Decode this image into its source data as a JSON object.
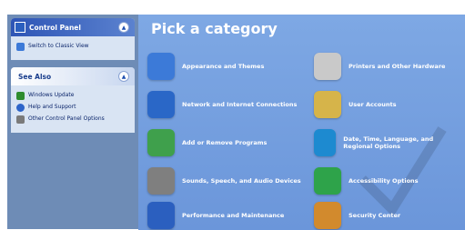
{
  "sidebar": {
    "control_panel": {
      "title": "Control Panel",
      "items": [
        {
          "label": "Switch to Classic View",
          "icon": "switch-icon"
        }
      ]
    },
    "see_also": {
      "title": "See Also",
      "items": [
        {
          "label": "Windows Update",
          "icon": "windows-update-icon"
        },
        {
          "label": "Help and Support",
          "icon": "help-icon"
        },
        {
          "label": "Other Control Panel Options",
          "icon": "options-icon"
        }
      ]
    }
  },
  "main": {
    "heading": "Pick a category",
    "categories": [
      {
        "label": "Appearance and Themes",
        "icon": "appearance-icon",
        "color": "#3c7ad8"
      },
      {
        "label": "Network and Internet Connections",
        "icon": "network-icon",
        "color": "#2a67c7"
      },
      {
        "label": "Add or Remove Programs",
        "icon": "programs-icon",
        "color": "#3fa04c"
      },
      {
        "label": "Sounds, Speech, and Audio Devices",
        "icon": "sound-icon",
        "color": "#7f7f7f"
      },
      {
        "label": "Performance and Maintenance",
        "icon": "performance-icon",
        "color": "#2b5fbf"
      },
      {
        "label": "Printers and Other Hardware",
        "icon": "printer-icon",
        "color": "#c9c9c9"
      },
      {
        "label": "User Accounts",
        "icon": "users-icon",
        "color": "#d6b44a"
      },
      {
        "label": "Date, Time, Language, and Regional Options",
        "icon": "datetime-icon",
        "color": "#1d8ad0"
      },
      {
        "label": "Accessibility Options",
        "icon": "accessibility-icon",
        "color": "#2ea34a"
      },
      {
        "label": "Security Center",
        "icon": "security-icon",
        "color": "#d28a2d"
      }
    ]
  },
  "colors": {
    "sidebar_bg": "#6e8cb6",
    "panel_bg": "#d9e4f3",
    "main_bg": "#7ea8e4",
    "link": "#0a246a"
  }
}
